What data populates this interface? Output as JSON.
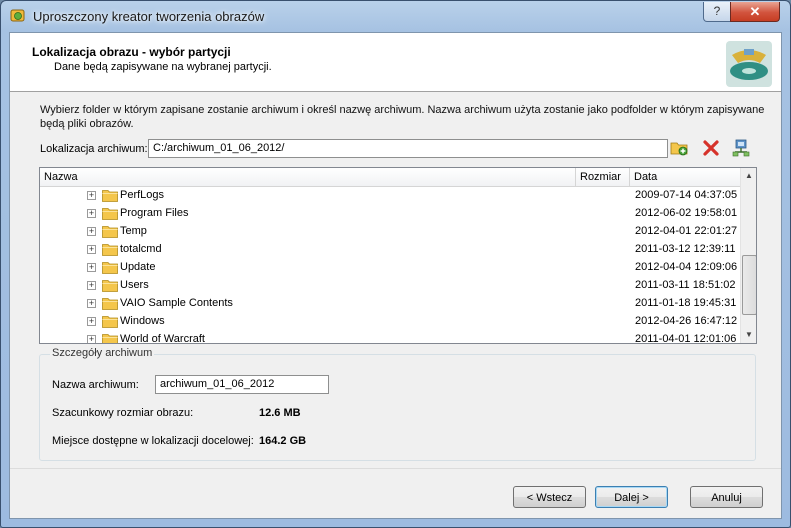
{
  "window": {
    "title": "Uproszczony kreator tworzenia obrazów",
    "help_label": "?",
    "close_label": "✕"
  },
  "header": {
    "title": "Lokalizacja obrazu - wybór partycji",
    "subtitle": "Dane będą zapisywane na wybranej partycji."
  },
  "instructions": "Wybierz folder w którym zapisane zostanie archiwum i określ nazwę archiwum. Nazwa archiwum użyta zostanie jako podfolder w którym zapisywane będą pliki obrazów.",
  "location": {
    "label": "Lokalizacja archiwum:",
    "value": "C:/archiwum_01_06_2012/"
  },
  "tree": {
    "columns": [
      "Nazwa",
      "Rozmiar",
      "Data"
    ],
    "rows": [
      {
        "name": "PerfLogs",
        "size": "",
        "date": "2009-07-14 04:37:05"
      },
      {
        "name": "Program Files",
        "size": "",
        "date": "2012-06-02 19:58:01"
      },
      {
        "name": "Temp",
        "size": "",
        "date": "2012-04-01 22:01:27"
      },
      {
        "name": "totalcmd",
        "size": "",
        "date": "2011-03-12 12:39:11"
      },
      {
        "name": "Update",
        "size": "",
        "date": "2012-04-04 12:09:06"
      },
      {
        "name": "Users",
        "size": "",
        "date": "2011-03-11 18:51:02"
      },
      {
        "name": "VAIO Sample Contents",
        "size": "",
        "date": "2011-01-18 19:45:31"
      },
      {
        "name": "Windows",
        "size": "",
        "date": "2012-04-26 16:47:12"
      },
      {
        "name": "World of Warcraft",
        "size": "",
        "date": "2011-04-01 12:01:06"
      }
    ]
  },
  "details": {
    "group_title": "Szczegóły archiwum",
    "name_label": "Nazwa archiwum:",
    "name_value": "archiwum_01_06_2012",
    "size_label": "Szacunkowy rozmiar obrazu:",
    "size_value": "12.6 MB",
    "free_label": "Miejsce dostępne w lokalizacji docelowej:",
    "free_value": "164.2 GB"
  },
  "buttons": {
    "back": "< Wstecz",
    "next": "Dalej >",
    "cancel": "Anuluj"
  },
  "icons": {
    "add": "folder-add-icon",
    "delete": "delete-icon",
    "network": "network-icon"
  },
  "colors": {
    "accent": "#3c7fb1",
    "close": "#c63d23",
    "folder": "#f4c64b"
  }
}
